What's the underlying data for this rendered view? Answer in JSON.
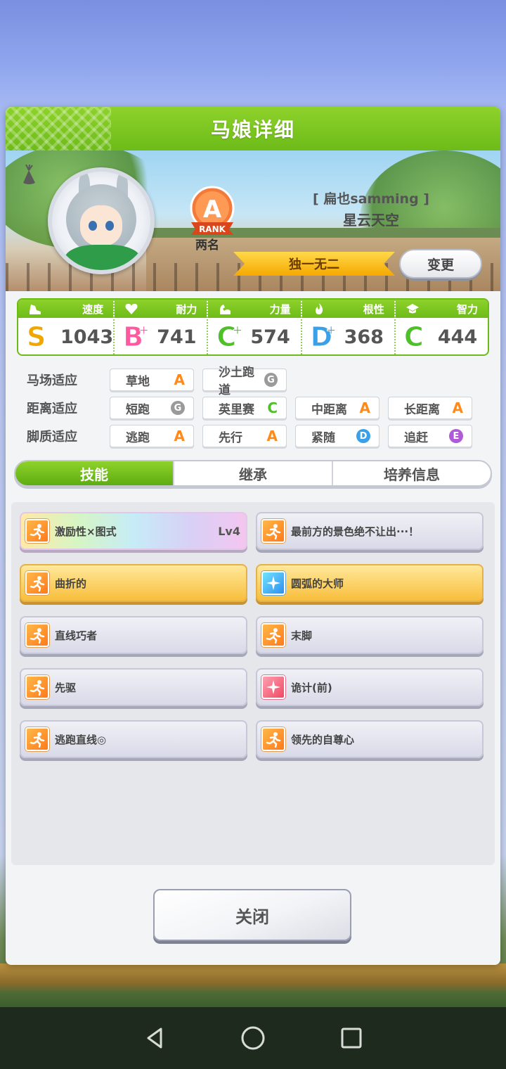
{
  "panel": {
    "title": "马娘详细"
  },
  "character": {
    "rank_letter": "A",
    "rank_label": "RANK",
    "rank_position": "两名",
    "title": "[ 扁也samming ]",
    "name": "星云天空",
    "ribbon": "独一无二",
    "change_label": "变更"
  },
  "stats": [
    {
      "label": "速度",
      "grade": "S",
      "plus": "",
      "value": "1043",
      "color": "#f0a800",
      "icon": "shoe-icon"
    },
    {
      "label": "耐力",
      "grade": "B",
      "plus": "+",
      "value": "741",
      "color": "#ff5aa0",
      "icon": "heart-icon"
    },
    {
      "label": "力量",
      "grade": "C",
      "plus": "+",
      "value": "574",
      "color": "#4fbf2a",
      "icon": "muscle-icon"
    },
    {
      "label": "根性",
      "grade": "D",
      "plus": "+",
      "value": "368",
      "color": "#3aa0e8",
      "icon": "flame-icon"
    },
    {
      "label": "智力",
      "grade": "C",
      "plus": "",
      "value": "444",
      "color": "#4fbf2a",
      "icon": "graduation-cap-icon"
    }
  ],
  "aptitudes": [
    {
      "label": "马场适应",
      "cells": [
        {
          "name": "草地",
          "grade": "A",
          "color": "#ff8a1a"
        },
        {
          "name": "沙土跑道",
          "grade": "G",
          "color": "#9a9a9a"
        }
      ]
    },
    {
      "label": "距离适应",
      "cells": [
        {
          "name": "短跑",
          "grade": "G",
          "color": "#9a9a9a"
        },
        {
          "name": "英里赛",
          "grade": "C",
          "color": "#4fbf2a"
        },
        {
          "name": "中距离",
          "grade": "A",
          "color": "#ff8a1a"
        },
        {
          "name": "长距离",
          "grade": "A",
          "color": "#ff8a1a"
        }
      ]
    },
    {
      "label": "脚质适应",
      "cells": [
        {
          "name": "逃跑",
          "grade": "A",
          "color": "#ff8a1a"
        },
        {
          "name": "先行",
          "grade": "A",
          "color": "#ff8a1a"
        },
        {
          "name": "紧随",
          "grade": "D",
          "color": "#3aa0e8"
        },
        {
          "name": "追赶",
          "grade": "E",
          "color": "#b05ad8"
        }
      ]
    }
  ],
  "tabs": [
    "技能",
    "继承",
    "培养信息"
  ],
  "skills": [
    {
      "name": "激励性×图式",
      "level": "Lv4",
      "style": "rainbow",
      "icon": "runner-icon"
    },
    {
      "name": "最前方的景色绝不让出···！",
      "level": "",
      "style": "plain",
      "icon": "runner-icon"
    },
    {
      "name": "曲折的",
      "level": "",
      "style": "gold",
      "icon": "runner-icon"
    },
    {
      "name": "圆弧的大师",
      "level": "",
      "style": "gold",
      "icon": "sparkle-icon"
    },
    {
      "name": "直线巧者",
      "level": "",
      "style": "plain",
      "icon": "runner-icon"
    },
    {
      "name": "末脚",
      "level": "",
      "style": "plain",
      "icon": "runner-icon"
    },
    {
      "name": "先驱",
      "level": "",
      "style": "plain",
      "icon": "runner-icon"
    },
    {
      "name": "诡计(前)",
      "level": "",
      "style": "plain",
      "icon": "sparkle-red-icon"
    },
    {
      "name": "逃跑直线◎",
      "level": "",
      "style": "plain",
      "icon": "runner-icon"
    },
    {
      "name": "领先的自尊心",
      "level": "",
      "style": "plain",
      "icon": "runner-icon"
    }
  ],
  "close_label": "关闭"
}
